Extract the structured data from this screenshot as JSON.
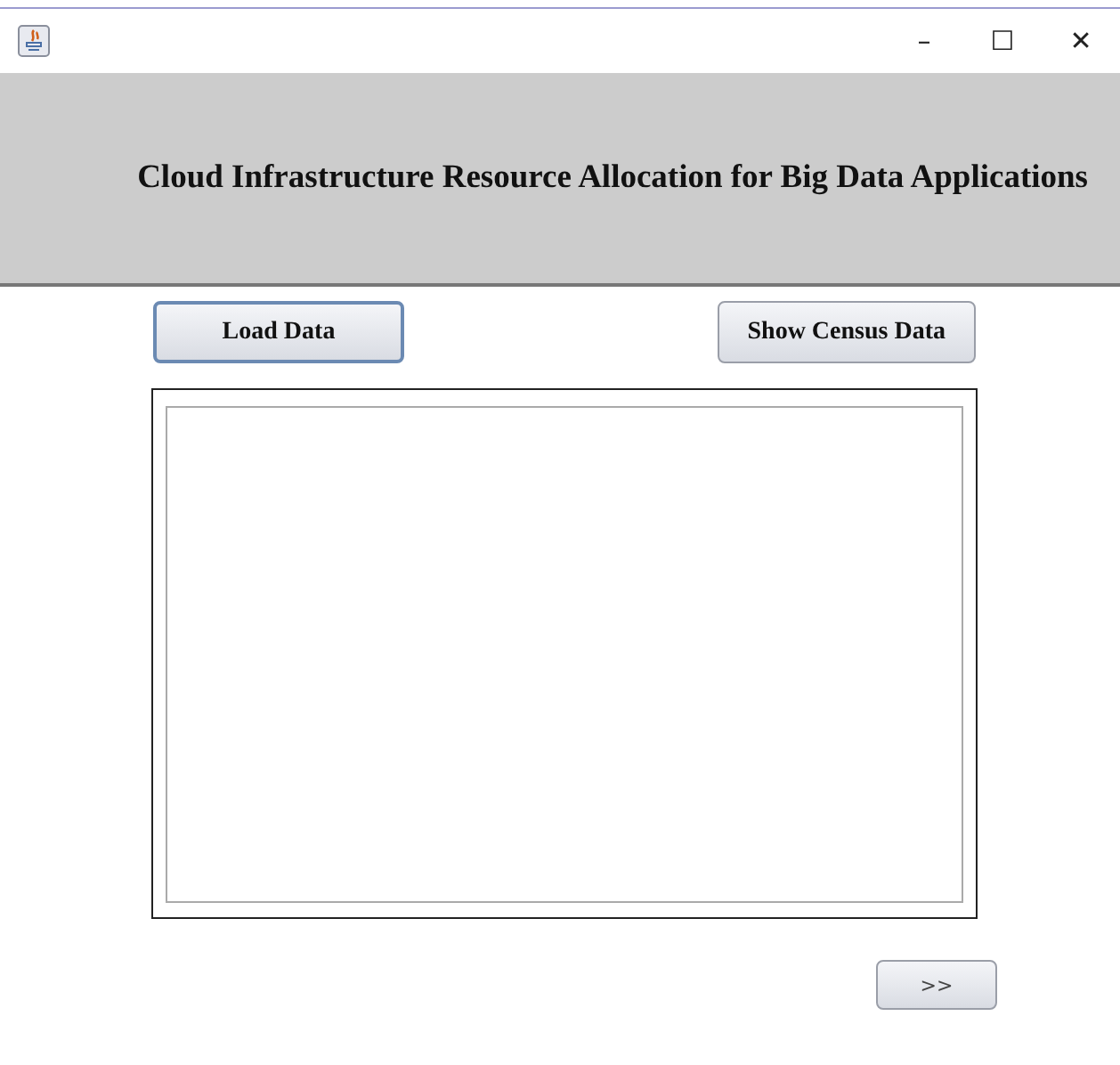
{
  "window": {
    "controls": [
      "–",
      "☐",
      "✕"
    ]
  },
  "header": {
    "title": "Cloud Infrastructure Resource Allocation for Big Data Applications"
  },
  "buttons": [
    {
      "label": "Load Data",
      "focused": true
    },
    {
      "label": "Show Census Data",
      "focused": false
    }
  ],
  "next_button": {
    "label": ">>"
  }
}
